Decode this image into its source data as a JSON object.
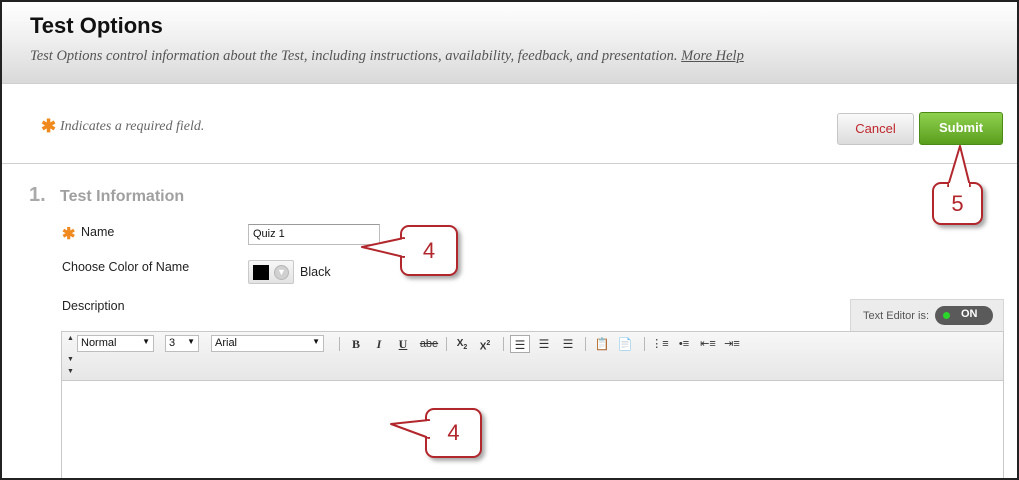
{
  "header": {
    "title": "Test Options",
    "subtitle": "Test Options control information about the Test, including instructions, availability, feedback, and presentation.",
    "more_help": "More Help"
  },
  "required_note": "Indicates a required field.",
  "actions": {
    "cancel": "Cancel",
    "submit": "Submit"
  },
  "section": {
    "number": "1.",
    "title": "Test Information",
    "name_label": "Name",
    "name_value": "Quiz 1",
    "color_label": "Choose Color of Name",
    "color_value": "Black",
    "description_label": "Description"
  },
  "editor": {
    "text_editor_label": "Text Editor is:",
    "text_editor_state": "ON",
    "format": "Normal",
    "size": "3",
    "font": "Arial",
    "tools": [
      "bold-icon",
      "italic-icon",
      "underline-icon",
      "strikethrough-icon",
      "subscript-icon",
      "superscript-icon",
      "align-left-icon",
      "align-center-icon",
      "align-right-icon",
      "paste-icon",
      "paste-word-icon",
      "numbered-list-icon",
      "bullet-list-icon",
      "outdent-icon",
      "indent-icon"
    ]
  },
  "callouts": {
    "name": "4",
    "description": "4",
    "submit": "5"
  },
  "colors": {
    "accent_red": "#b1272c",
    "submit_green": "#6cb02e",
    "required_orange": "#f0891e"
  }
}
